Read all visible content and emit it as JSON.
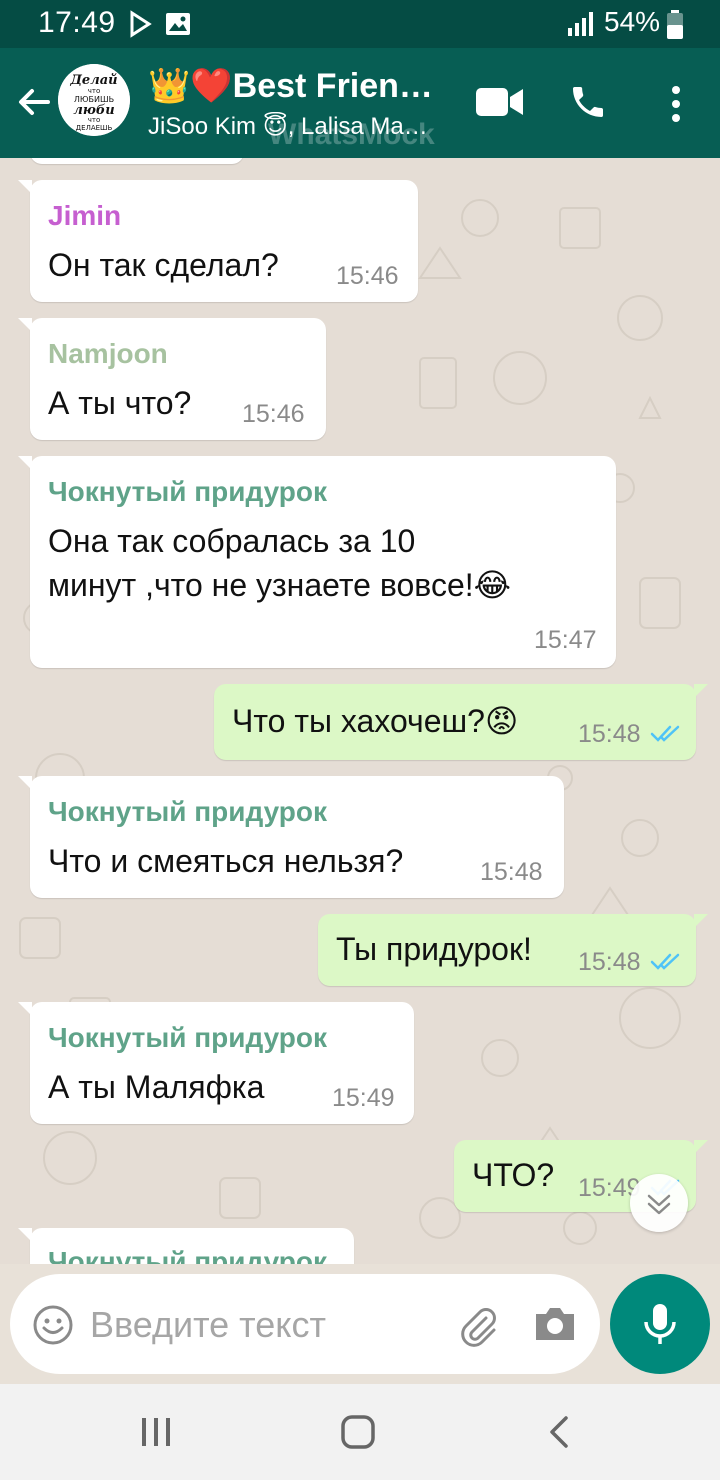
{
  "status_bar": {
    "time": "17:49",
    "battery": "54%",
    "icons": [
      "play-icon",
      "image-icon",
      "signal-icon",
      "battery-icon"
    ]
  },
  "header": {
    "back_icon": "arrow-left-icon",
    "avatar_text": "Делай что любишь люби что делаешь",
    "title": "👑❤️Best Frien…",
    "subtitle": "JiSoo Kim 😇, Lalisa Ma…",
    "watermark": "WhatsMock",
    "actions": [
      "video-call-icon",
      "voice-call-icon",
      "more-vert-icon"
    ]
  },
  "messages": [
    {
      "dir": "in",
      "sender": "Jimin",
      "sender_color": "#c65fd0",
      "lines": [
        "Он так сделал?"
      ],
      "time": "15:46"
    },
    {
      "dir": "in",
      "sender": "Namjoon",
      "sender_color": "#a7c2a0",
      "lines": [
        "А ты что?"
      ],
      "time": "15:46"
    },
    {
      "dir": "in",
      "sender": "Чокнутый придурок",
      "sender_color": "#5fa389",
      "lines": [
        "Она так собралась за 10",
        "минут ,что не узнаете вовсе!😂"
      ],
      "time": "15:47"
    },
    {
      "dir": "out",
      "lines": [
        "Что ты хахочеш?😡"
      ],
      "time": "15:48",
      "read": true
    },
    {
      "dir": "in",
      "sender": "Чокнутый придурок",
      "sender_color": "#5fa389",
      "lines": [
        "Что и смеяться нельзя?"
      ],
      "time": "15:48"
    },
    {
      "dir": "out",
      "lines": [
        "Ты придурок!"
      ],
      "time": "15:48",
      "read": true
    },
    {
      "dir": "in",
      "sender": "Чокнутый придурок",
      "sender_color": "#5fa389",
      "lines": [
        "А ты Маляфка"
      ],
      "time": "15:49"
    },
    {
      "dir": "out",
      "lines": [
        "ЧТО?"
      ],
      "time": "15:49",
      "read": true
    },
    {
      "dir": "in",
      "sender": "Чокнутый придурок",
      "sender_color": "#5fa389",
      "lines": [],
      "time": ""
    }
  ],
  "composer": {
    "placeholder": "Введите текст",
    "emoji_icon": "emoji-icon",
    "attach_icon": "paperclip-icon",
    "camera_icon": "camera-icon",
    "mic_icon": "mic-icon"
  },
  "colors": {
    "header": "#075e54",
    "status_bar": "#054c44",
    "outgoing_bubble": "#dcf8c6",
    "incoming_bubble": "#ffffff",
    "read_ticks": "#4fc3f7",
    "mic_button": "#00897b"
  },
  "nav": [
    "recents-icon",
    "home-icon",
    "back-icon"
  ]
}
